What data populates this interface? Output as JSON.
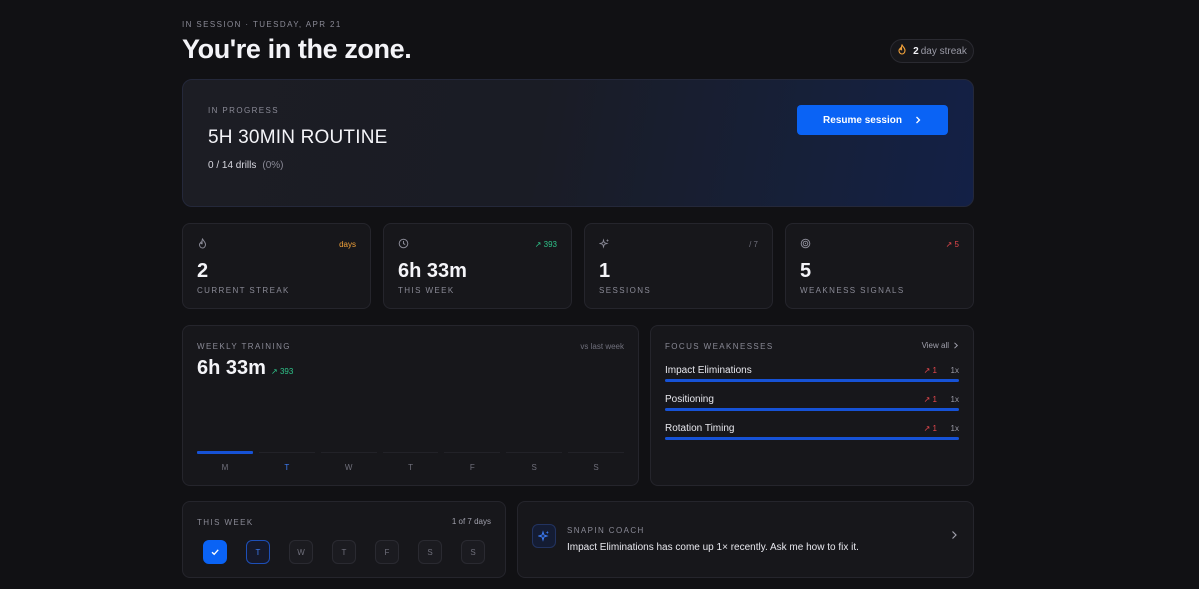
{
  "header": {
    "kicker": "IN SESSION · TUESDAY, APR 21",
    "headline": "You're in the zone.",
    "streak_count": "2",
    "streak_label": "day streak"
  },
  "hero": {
    "eyebrow": "IN PROGRESS",
    "title": "5H 30MIN ROUTINE",
    "drills": "0 / 14 drills",
    "percent": "(0%)",
    "resume_label": "Resume session"
  },
  "stats": [
    {
      "icon": "flame-icon",
      "tag": "days",
      "value": "2",
      "label": "CURRENT STREAK"
    },
    {
      "icon": "clock-icon",
      "tag": "393",
      "value": "6h 33m",
      "label": "THIS WEEK"
    },
    {
      "icon": "sparkle-icon",
      "tag": "/ 7",
      "value": "1",
      "label": "SESSIONS"
    },
    {
      "icon": "target-icon",
      "tag": "5",
      "value": "5",
      "label": "WEAKNESS SIGNALS"
    }
  ],
  "weekly": {
    "title": "WEEKLY TRAINING",
    "compare": "vs last week",
    "total": "6h 33m",
    "delta": "393",
    "days": [
      "M",
      "T",
      "W",
      "T",
      "F",
      "S",
      "S"
    ],
    "today_index": 1,
    "minutes": [
      393,
      0,
      0,
      0,
      0,
      0,
      0
    ]
  },
  "focus": {
    "title": "FOCUS WEAKNESSES",
    "view_all": "View all",
    "items": [
      {
        "name": "Impact Eliminations",
        "trend": "1",
        "count": "1x",
        "level": 1.0
      },
      {
        "name": "Positioning",
        "trend": "1",
        "count": "1x",
        "level": 1.0
      },
      {
        "name": "Rotation Timing",
        "trend": "1",
        "count": "1x",
        "level": 1.0
      }
    ]
  },
  "this_week": {
    "title": "THIS WEEK",
    "fraction": "1 of 7 days",
    "days": [
      "M",
      "T",
      "W",
      "T",
      "F",
      "S",
      "S"
    ]
  },
  "coach": {
    "eyebrow": "SNAPIN COACH",
    "message": "Impact Eliminations has come up 1× recently. Ask me how to fix it."
  },
  "colors": {
    "accent": "#0a63f5",
    "positive": "#2fc48a",
    "negative": "#e5484d",
    "streak": "#f2a23a"
  }
}
